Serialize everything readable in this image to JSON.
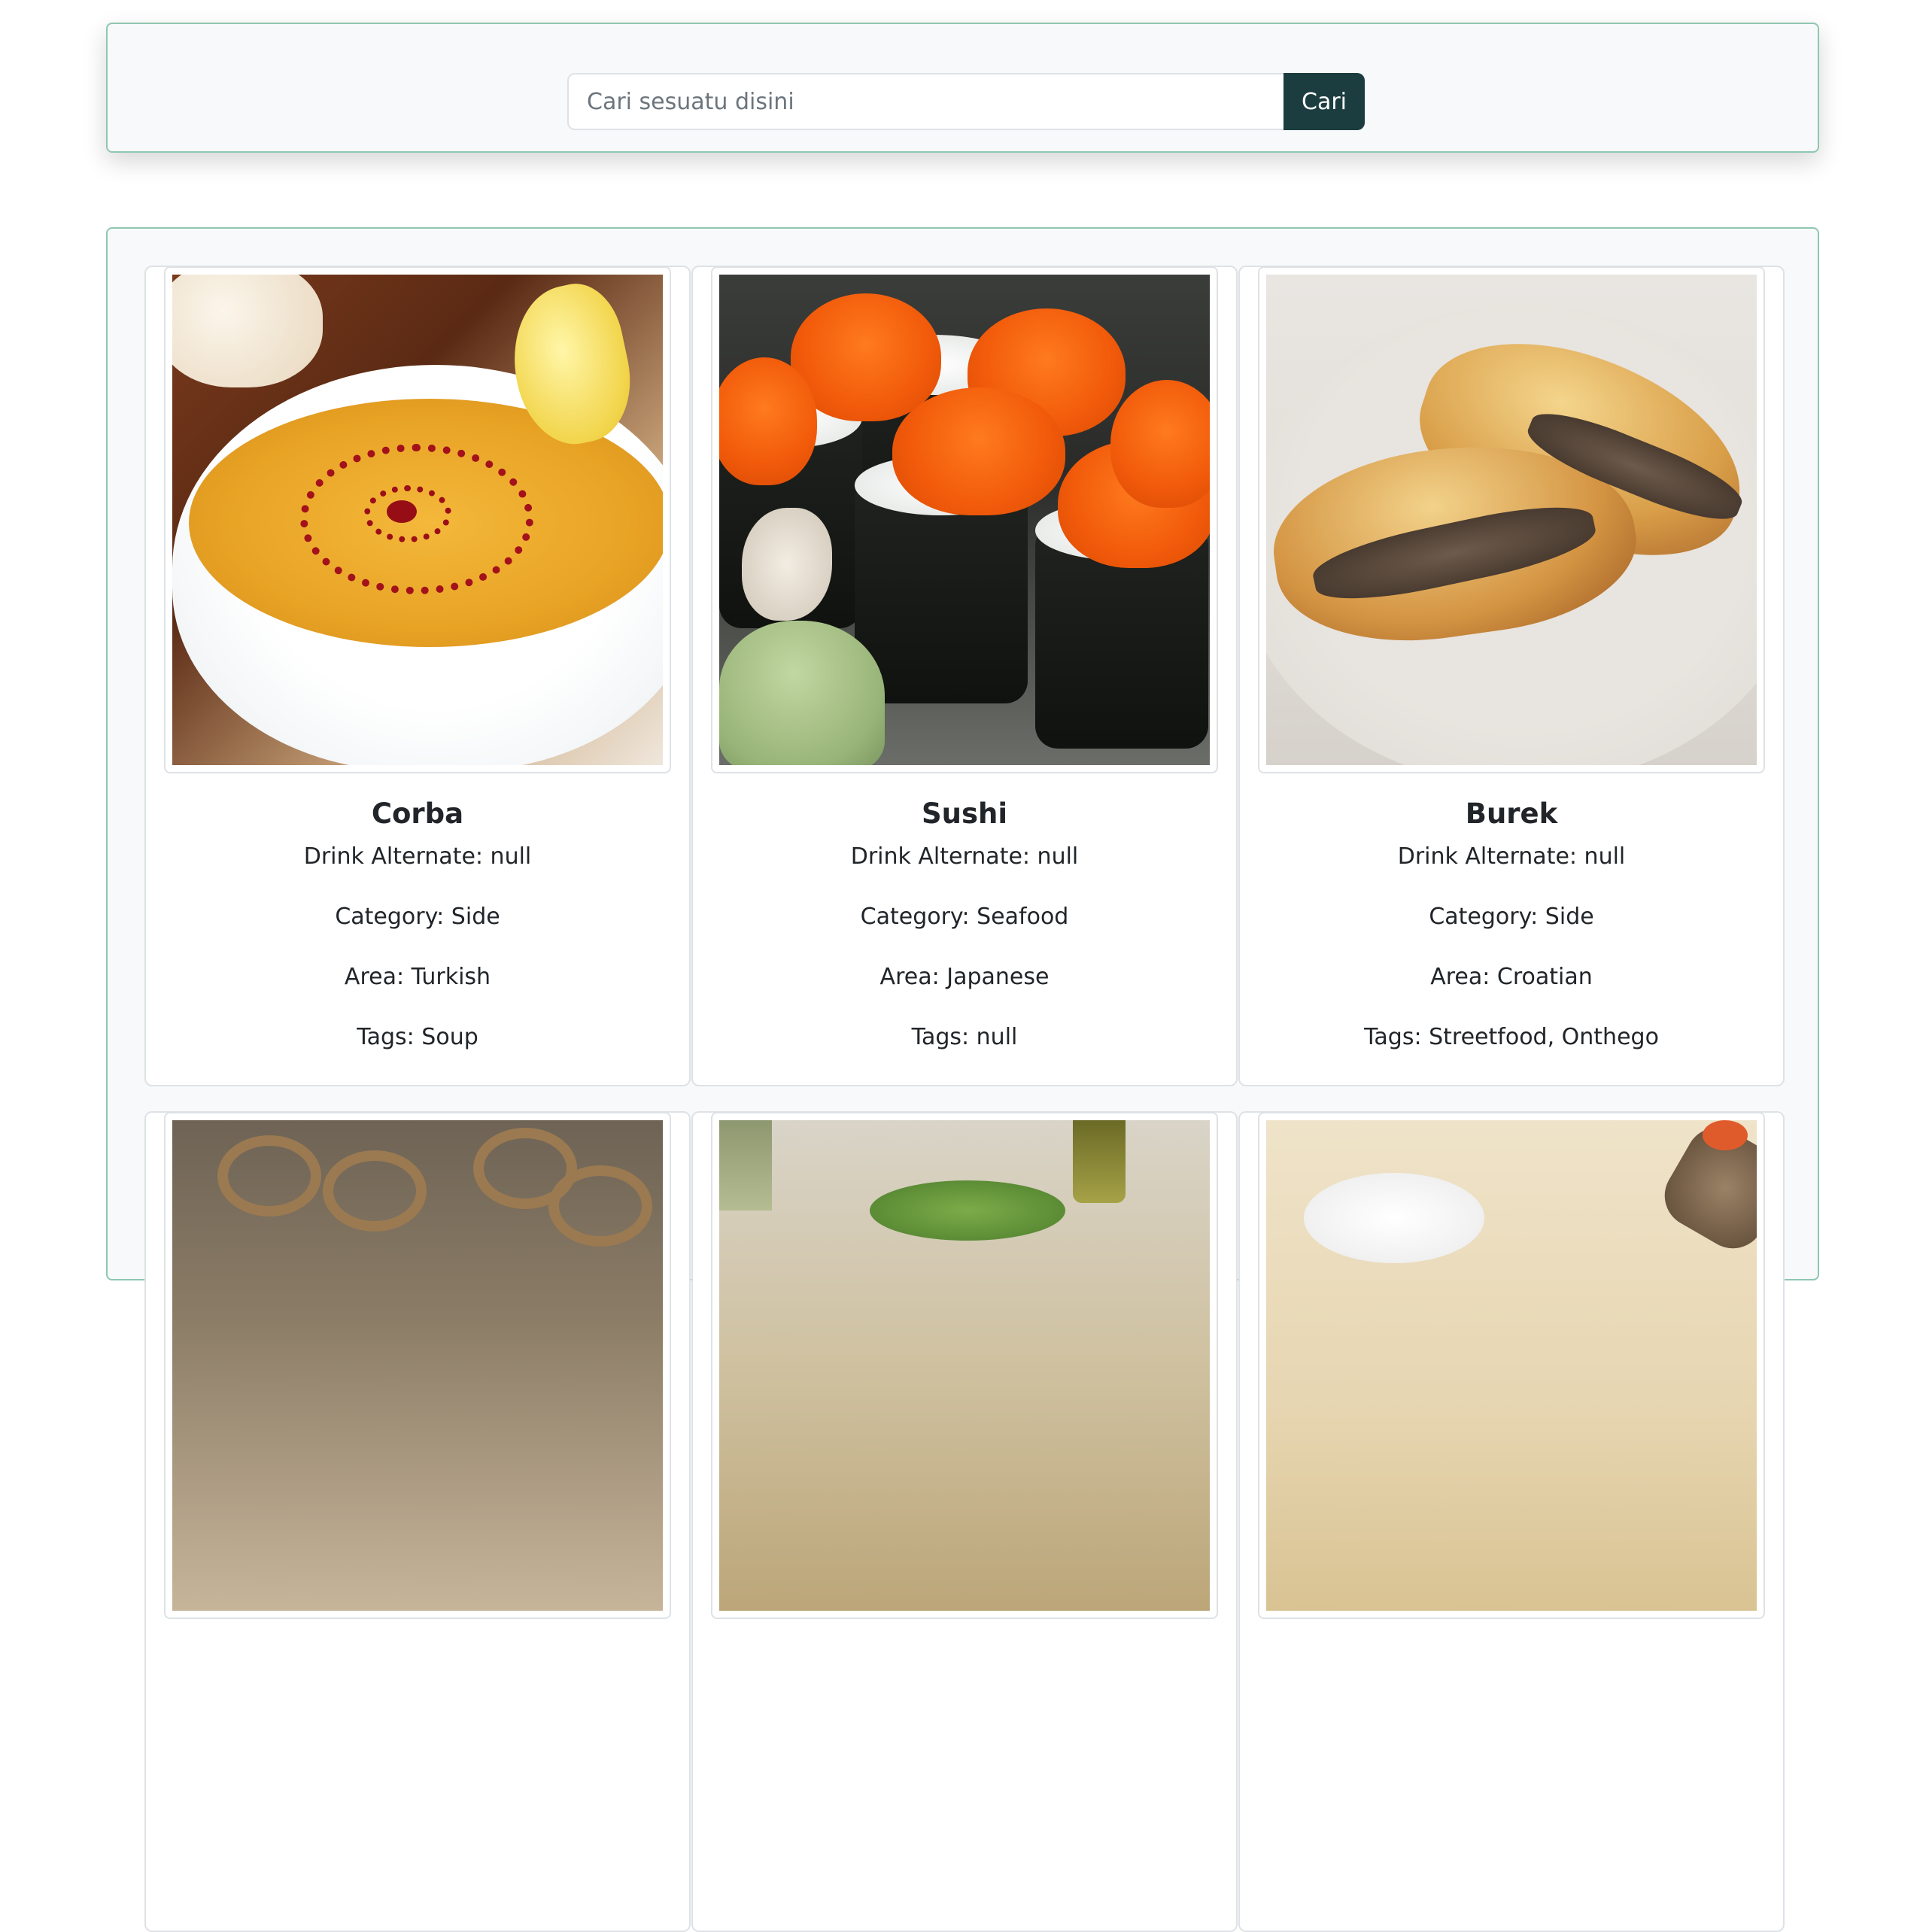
{
  "search": {
    "placeholder": "Cari sesuatu disini",
    "value": "",
    "button_label": "Cari",
    "button_color": "#1c3d3f"
  },
  "accent_border_color": "#8fc7b0",
  "meals": [
    {
      "name": "Corba",
      "drink_alternate": "Drink Alternate: null",
      "category": "Category: Side",
      "area": "Area: Turkish",
      "tags": "Tags: Soup",
      "image": "lentil-soup-photo"
    },
    {
      "name": "Sushi",
      "drink_alternate": "Drink Alternate: null",
      "category": "Category: Seafood",
      "area": "Area: Japanese",
      "tags": "Tags: null",
      "image": "sushi-rolls-photo"
    },
    {
      "name": "Burek",
      "drink_alternate": "Drink Alternate: null",
      "category": "Category: Side",
      "area": "Area: Croatian",
      "tags": "Tags: Streetfood, Onthego",
      "image": "burek-pastry-photo"
    },
    {
      "image": "onion-meat-dish-photo"
    },
    {
      "image": "salad-table-photo"
    },
    {
      "image": "wrap-plate-photo"
    }
  ]
}
